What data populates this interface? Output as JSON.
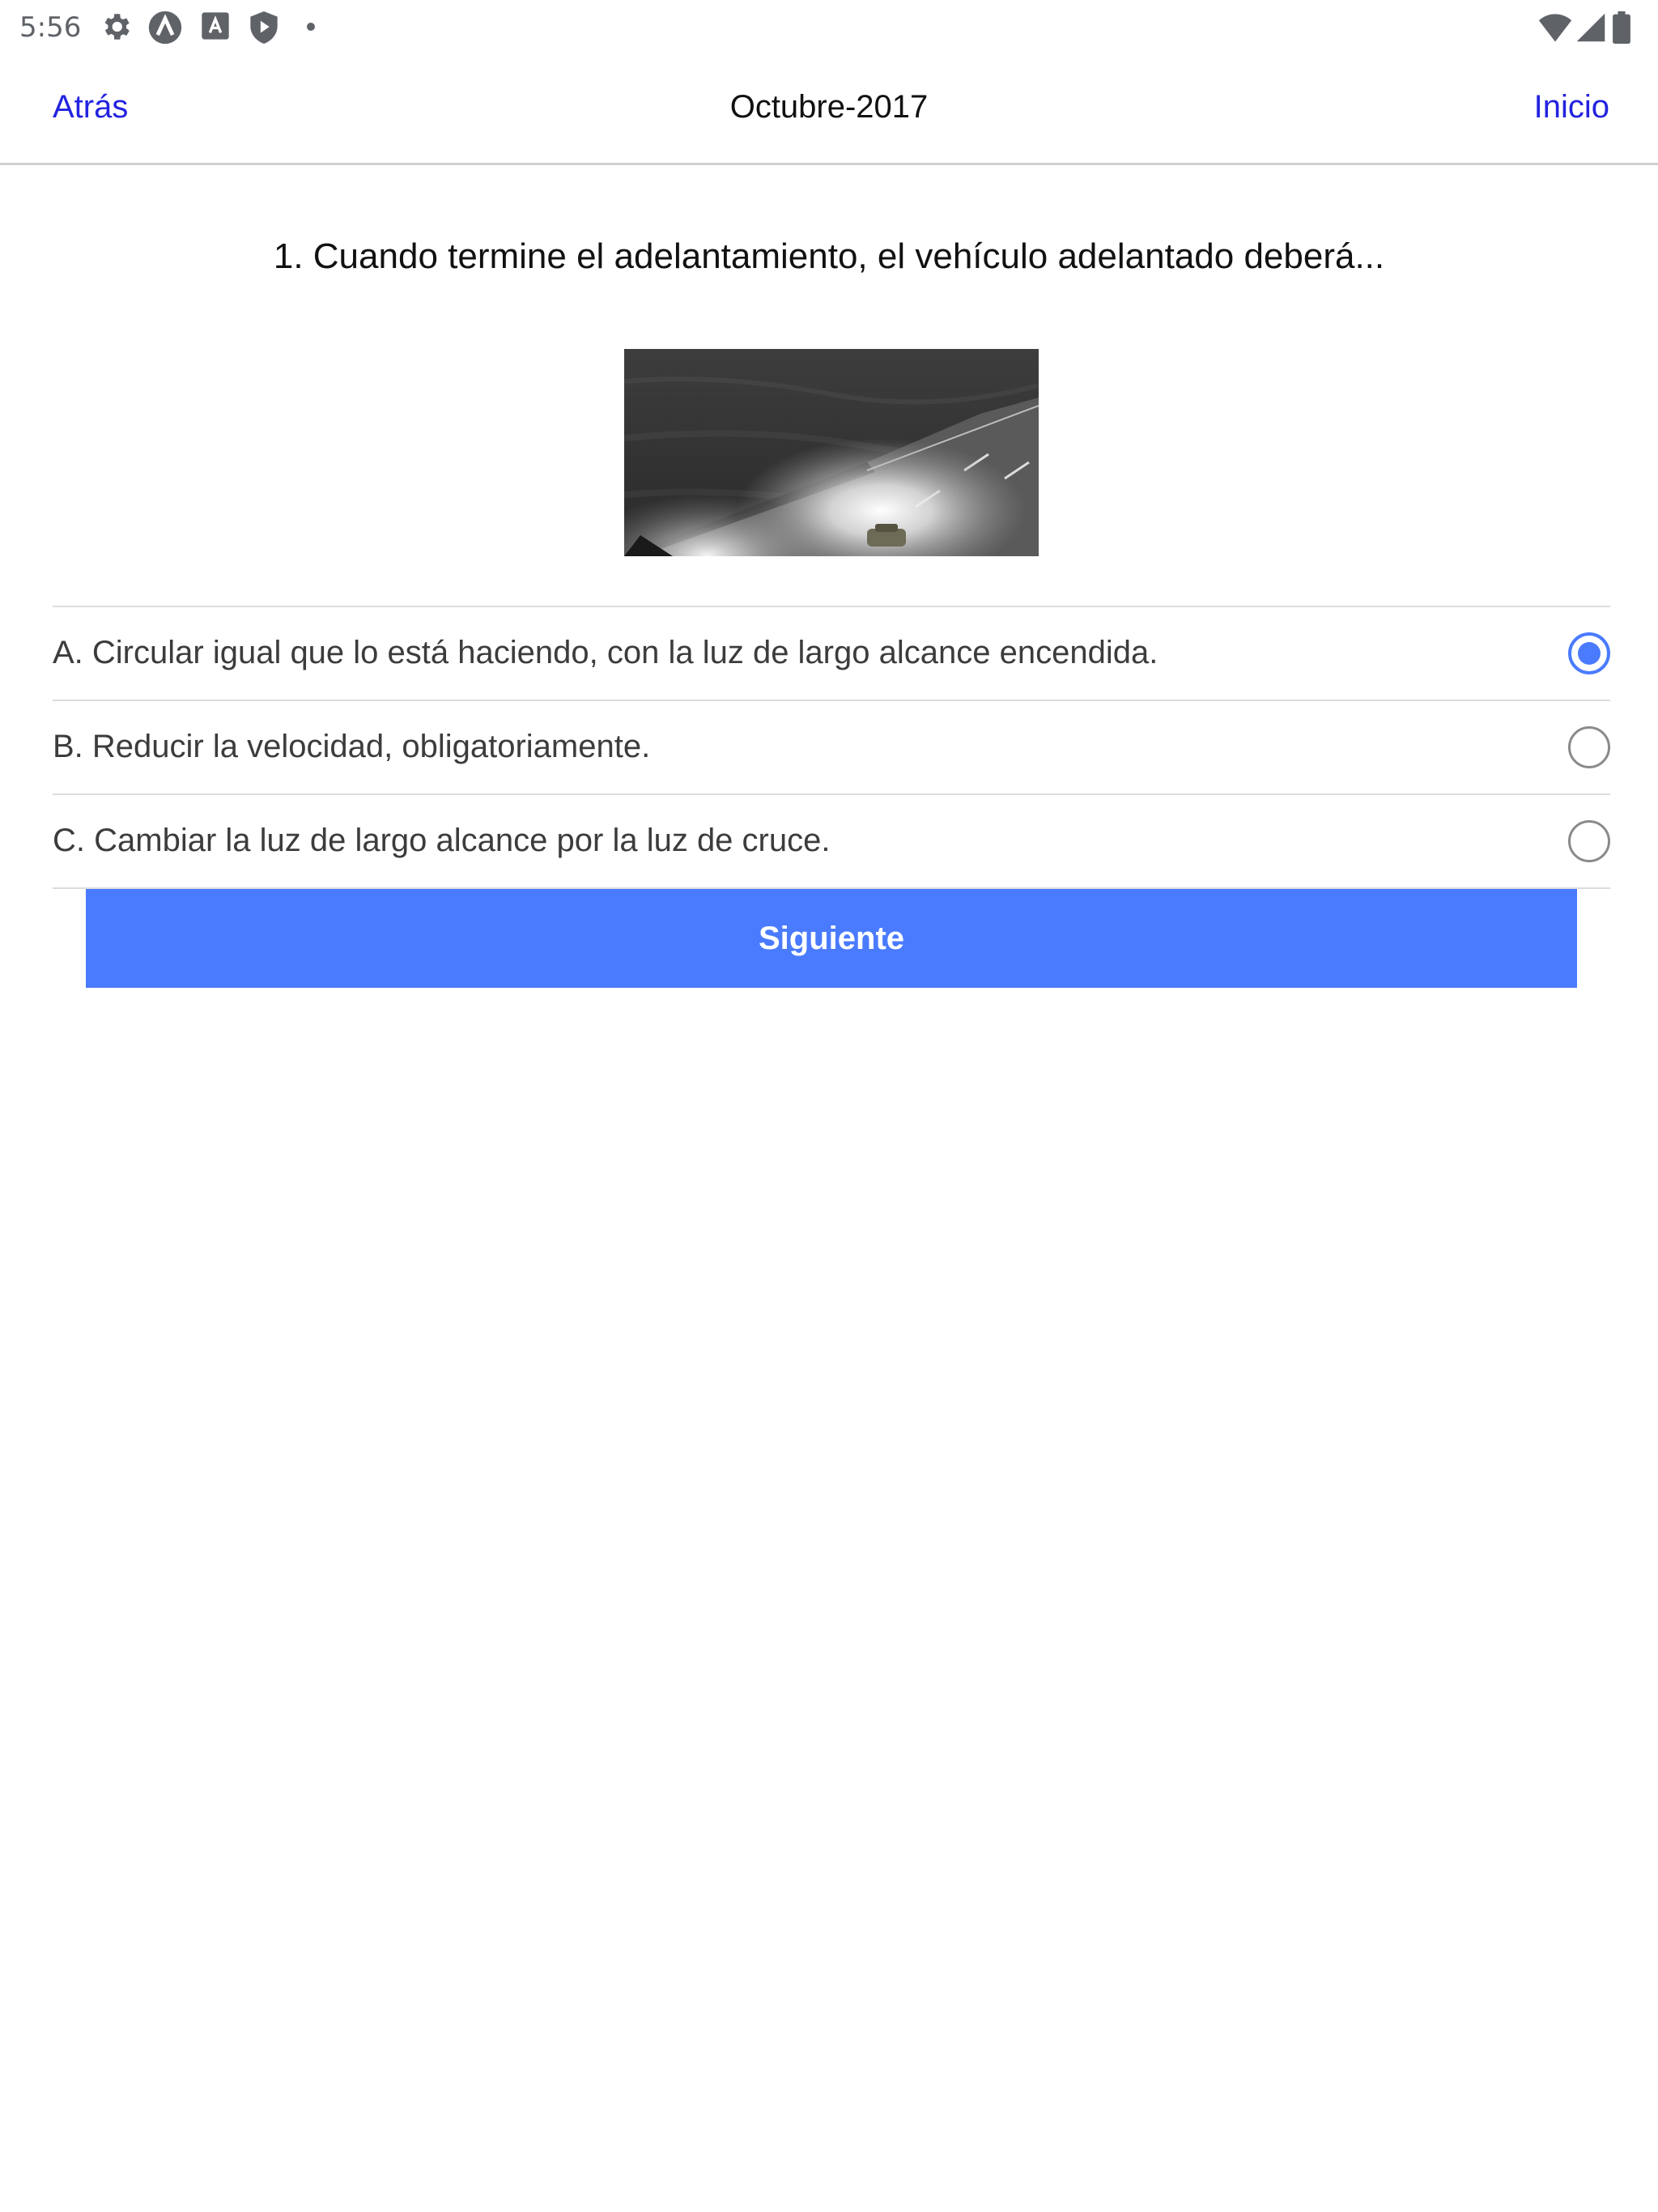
{
  "status_bar": {
    "time": "5:56",
    "left_icons": [
      "gear-icon",
      "a-circle-icon",
      "a-square-icon",
      "shield-play-icon",
      "dot-icon"
    ],
    "right_icons": [
      "wifi-icon",
      "signal-icon",
      "battery-icon"
    ]
  },
  "nav": {
    "back_label": "Atrás",
    "title": "Octubre-2017",
    "home_label": "Inicio"
  },
  "question": {
    "text": "1. Cuando termine el adelantamiento, el vehículo adelantado deberá..."
  },
  "options": [
    {
      "label": "A. Circular igual que lo está haciendo, con la luz de largo alcance encendida.",
      "selected": true
    },
    {
      "label": "B. Reducir la velocidad, obligatoriamente.",
      "selected": false
    },
    {
      "label": "C. Cambiar la luz de largo alcance por la luz de cruce.",
      "selected": false
    }
  ],
  "next_button": {
    "label": "Siguiente"
  },
  "colors": {
    "link": "#2323e0",
    "accent": "#4a7bff",
    "divider": "#dcdcdc"
  }
}
